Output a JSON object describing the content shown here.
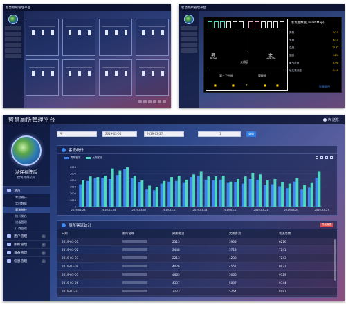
{
  "app": {
    "title": "智慧厕所管理平台",
    "user_label": "Pi 送东",
    "org_name": "湖保福陈后",
    "org_sub": "建筑有限公司",
    "screen_a_title": "智慧厕所管理平台",
    "screen_b_title": "智慧厕所管理平台"
  },
  "sidebar": {
    "groups": [
      {
        "label": "总览",
        "active": true
      },
      {
        "label": "用户管理",
        "active": false
      },
      {
        "label": "厕所管理",
        "active": false
      },
      {
        "label": "设备管理",
        "active": false
      },
      {
        "label": "信息管理",
        "active": false
      }
    ],
    "subitems": [
      "考勤统计",
      "实时数据",
      "客流统计",
      "统计排名",
      "设备管理",
      "厂商管理"
    ],
    "active_sub": 2
  },
  "filter": {
    "select_placeholder": "所",
    "date_start": "2019-03-04",
    "date_end": "2019-03-27",
    "type_select": "1",
    "query_label": "查询"
  },
  "chart_panel": {
    "title": "客流统计"
  },
  "chart_data": {
    "type": "bar",
    "title": "",
    "series": [
      {
        "name": "男厕客流",
        "color": "#3f86f0",
        "values": [
          3400,
          3900,
          4300,
          4400,
          4200,
          4800,
          5700,
          4300,
          3700,
          2600,
          2500,
          3500,
          3800,
          3900,
          3600,
          4500,
          4700,
          4100,
          4000,
          4100,
          3600,
          3700,
          3500,
          4200,
          4100,
          3300,
          3400,
          3100,
          2800,
          3800,
          2600,
          2900,
          4400
        ]
      },
      {
        "name": "女厕客流",
        "color": "#4fd9c0",
        "values": [
          4000,
          4600,
          4500,
          4700,
          5800,
          5500,
          6000,
          4700,
          4000,
          3200,
          3000,
          3900,
          4500,
          4700,
          4100,
          4900,
          5300,
          4600,
          4600,
          4700,
          3800,
          4200,
          4600,
          5100,
          4900,
          4000,
          4200,
          3700,
          3500,
          4300,
          3300,
          3600,
          5300
        ]
      }
    ],
    "categories": [
      "2019-03-01",
      "2019-03-02",
      "2019-03-03",
      "2019-03-04",
      "2019-03-05",
      "2019-03-06",
      "2019-03-07",
      "2019-03-08",
      "2019-03-09",
      "2019-03-10",
      "2019-03-11",
      "2019-03-12",
      "2019-03-13",
      "2019-03-14",
      "2019-03-15",
      "2019-03-16",
      "2019-03-17",
      "2019-03-18",
      "2019-03-19",
      "2019-03-20",
      "2019-03-21",
      "2019-03-22",
      "2019-03-23",
      "2019-03-24",
      "2019-03-25",
      "2019-03-26",
      "2019-03-27",
      "2019-03-28",
      "2019-03-29",
      "2019-03-30",
      "2019-03-31",
      "2019-04-01",
      "2019-04-02"
    ],
    "tick_labels": [
      "2019-02-28",
      "2019-03-04",
      "2019-03-07",
      "2019-03-11",
      "2019-03-14",
      "2019-03-17",
      "2019-03-21",
      "2019-03-24",
      "2019-03-27"
    ],
    "yticks": [
      0,
      1000,
      2000,
      3000,
      4000,
      5000,
      6000
    ],
    "ylim": [
      0,
      6500
    ],
    "legend": "top-left",
    "grid": true
  },
  "table_panel": {
    "title": "厕所客流统计",
    "export_label": "导出数据",
    "headers": [
      "日期",
      "厕所名称",
      "男厕客流",
      "女厕客流",
      "客流总数"
    ],
    "rows": [
      {
        "date": "2019-03-01",
        "male": "2313",
        "female": "3903",
        "total": "6216"
      },
      {
        "date": "2019-03-02",
        "male": "2448",
        "female": "3713",
        "total": "7241"
      },
      {
        "date": "2019-03-03",
        "male": "2213",
        "female": "4238",
        "total": "7243"
      },
      {
        "date": "2019-03-04",
        "male": "4426",
        "female": "4551",
        "total": "8977"
      },
      {
        "date": "2019-03-05",
        "male": "4663",
        "female": "5066",
        "total": "9729"
      },
      {
        "date": "2019-03-06",
        "male": "4337",
        "female": "5007",
        "total": "9344"
      },
      {
        "date": "2019-03-07",
        "male": "3223",
        "female": "5264",
        "total": "8487"
      }
    ]
  },
  "map": {
    "title": "客流量数据(Toilet Map)",
    "men_label": "男",
    "men_label_en": "Male",
    "women_label": "女",
    "women_label_en": "Female",
    "mid_label": "公用区",
    "bottom_left_label": "第三卫生间",
    "bottom_right_label": "管理间",
    "stats": [
      {
        "label": "男厕",
        "value": "3/13"
      },
      {
        "label": "女厕",
        "value": "6/15"
      },
      {
        "label": "温度",
        "value": "21℃"
      },
      {
        "label": "湿度",
        "value": "44%"
      },
      {
        "label": "氨气浓度",
        "value": "0.00"
      },
      {
        "label": "硫化氢浓度",
        "value": "0.00"
      }
    ],
    "brand": "智慧厕所"
  },
  "colors": {
    "accent": "#2f7de0",
    "danger": "#e04848",
    "male_bar": "#3f86f0",
    "female_bar": "#4fd9c0",
    "signal": "#ffd400"
  }
}
